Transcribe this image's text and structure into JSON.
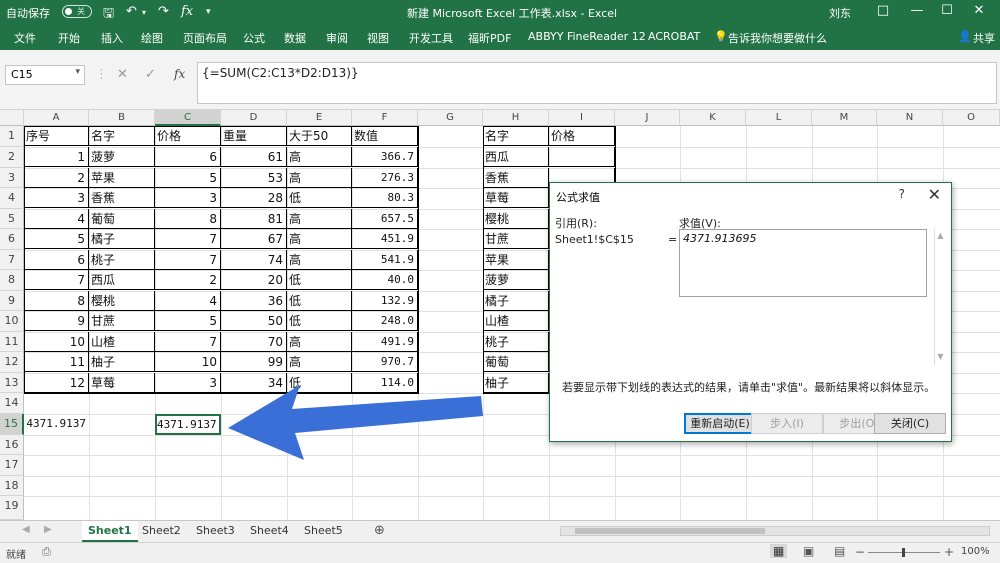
{
  "title_bar": {
    "autosave_label": "自动保存",
    "autosave_state": "关",
    "title": "新建 Microsoft Excel 工作表.xlsx - Excel",
    "user": "刘东"
  },
  "menu": [
    "文件",
    "开始",
    "插入",
    "绘图",
    "页面布局",
    "公式",
    "数据",
    "审阅",
    "视图",
    "开发工具",
    "福昕PDF",
    "ABBYY FineReader 12",
    "ACROBAT"
  ],
  "tell_me": "告诉我你想要做什么",
  "share": "共享",
  "formula_bar": {
    "name_box": "C15",
    "formula": "{=SUM(C2:C13*D2:D13)}"
  },
  "columns": [
    "A",
    "B",
    "C",
    "D",
    "E",
    "F",
    "G",
    "H",
    "I",
    "J",
    "K",
    "L",
    "M",
    "N",
    "O"
  ],
  "rows": [
    "1",
    "2",
    "3",
    "4",
    "5",
    "6",
    "7",
    "8",
    "9",
    "10",
    "11",
    "12",
    "13",
    "14",
    "15",
    "16",
    "17",
    "18",
    "19"
  ],
  "table_main": {
    "headers": [
      "序号",
      "名字",
      "价格",
      "重量",
      "大于50",
      "数值"
    ],
    "rows": [
      [
        "1",
        "菠萝",
        "6",
        "61",
        "高",
        "366.7"
      ],
      [
        "2",
        "苹果",
        "5",
        "53",
        "高",
        "276.3"
      ],
      [
        "3",
        "香蕉",
        "3",
        "28",
        "低",
        "80.3"
      ],
      [
        "4",
        "葡萄",
        "8",
        "81",
        "高",
        "657.5"
      ],
      [
        "5",
        "橘子",
        "7",
        "67",
        "高",
        "451.9"
      ],
      [
        "6",
        "桃子",
        "7",
        "74",
        "高",
        "541.9"
      ],
      [
        "7",
        "西瓜",
        "2",
        "20",
        "低",
        "40.0"
      ],
      [
        "8",
        "樱桃",
        "4",
        "36",
        "低",
        "132.9"
      ],
      [
        "9",
        "甘蔗",
        "5",
        "50",
        "低",
        "248.0"
      ],
      [
        "10",
        "山楂",
        "7",
        "70",
        "高",
        "491.9"
      ],
      [
        "11",
        "柚子",
        "10",
        "99",
        "高",
        "970.7"
      ],
      [
        "12",
        "草莓",
        "3",
        "34",
        "低",
        "114.0"
      ]
    ]
  },
  "table_side": {
    "headers": [
      "名字",
      "价格"
    ],
    "names": [
      "西瓜",
      "香蕉",
      "草莓",
      "樱桃",
      "甘蔗",
      "苹果",
      "菠萝",
      "橘子",
      "山楂",
      "桃子",
      "葡萄",
      "柚子"
    ]
  },
  "a15": "4371.9137",
  "c15": "4371.9137",
  "sheets": [
    "Sheet1",
    "Sheet2",
    "Sheet3",
    "Sheet4",
    "Sheet5"
  ],
  "status": {
    "ready": "就绪",
    "zoom": "100%"
  },
  "dialog": {
    "title": "公式求值",
    "help": "?",
    "ref_label": "引用(R):",
    "ref_value": "Sheet1!$C$15",
    "eq": "=",
    "value_label": "求值(V):",
    "value": "4371.913695",
    "hint": "若要显示带下划线的表达式的结果，请单击\"求值\"。最新结果将以斜体显示。",
    "buttons": [
      "重新启动(E)",
      "步入(I)",
      "步出(O)",
      "关闭(C)"
    ]
  },
  "colors": {
    "excel_green": "#217346",
    "arrow_blue": "#3a6fd8"
  }
}
